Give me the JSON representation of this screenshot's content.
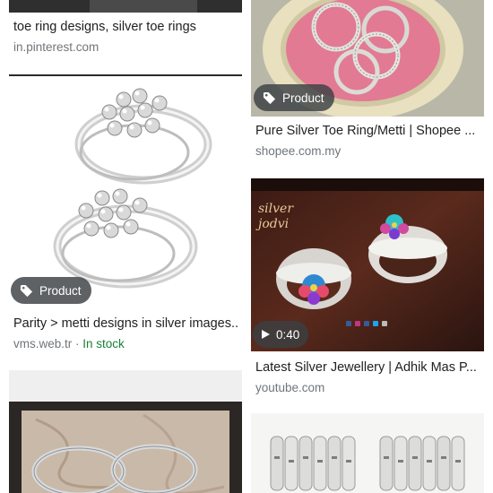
{
  "results": [
    {
      "title": "toe ring designs, silver toe rings",
      "source": "in.pinterest.com"
    },
    {
      "title": "Pure Silver Toe Ring/Metti | Shopee ...",
      "source": "shopee.com.my",
      "badge": "Product",
      "badge_icon": "tag-icon"
    },
    {
      "title": "Parity > metti designs in silver images...",
      "source": "vms.web.tr",
      "separator": " · ",
      "availability": "In stock",
      "badge": "Product",
      "badge_icon": "tag-icon"
    },
    {
      "title": "Latest Silver Jewellery | Adhik Mas P...",
      "source": "youtube.com",
      "duration": "0:40",
      "badge_icon": "play-icon",
      "overlay_text": [
        "silver",
        "jodvi"
      ]
    }
  ],
  "colors": {
    "title": "#202124",
    "source": "#70757a",
    "in_stock": "#188038",
    "badge_bg": "#3c4043"
  }
}
